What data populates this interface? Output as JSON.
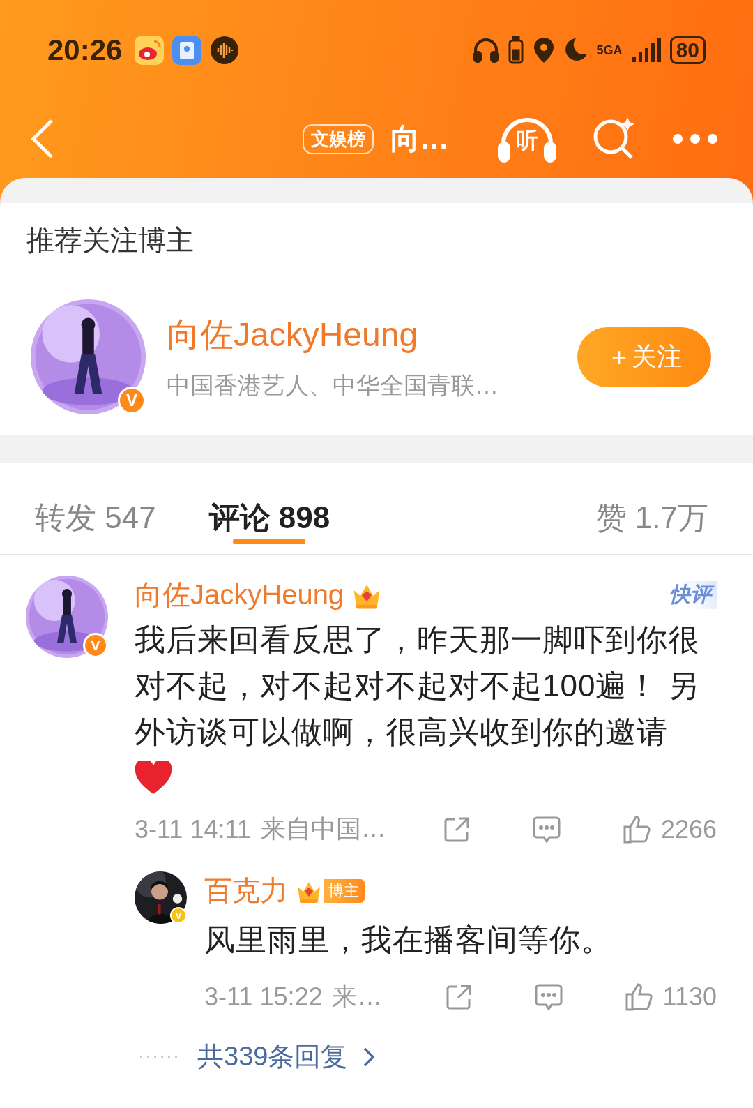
{
  "status_bar": {
    "time": "20:26",
    "network": "5GA",
    "battery": "80"
  },
  "nav": {
    "ranking_badge": "文娱榜",
    "title": "向…",
    "listen_label": "听"
  },
  "recommend": {
    "heading": "推荐关注博主",
    "user": {
      "name": "向佐JackyHeung",
      "verified_mark": "V",
      "bio": "中国香港艺人、中华全国青联…",
      "follow_button": "＋关注"
    }
  },
  "tabs": [
    {
      "label": "转发 547",
      "selected": false
    },
    {
      "label": "评论 898",
      "selected": true
    },
    {
      "label": "赞 1.7万",
      "selected": false
    }
  ],
  "comment": {
    "name": "向佐JackyHeung",
    "verified_mark": "V",
    "quick_badge": "快评",
    "text": "我后来回看反思了，昨天那一脚吓到你很对不起，对不起对不起对不起100遍！ 另外访谈可以做啊，很高兴收到你的邀请",
    "time": "3-11 14:11",
    "source": "来自中国…",
    "likes": "2266",
    "reply": {
      "name": "百克力",
      "verified_mark": "V",
      "role_badge": "博主",
      "text": "风里雨里，我在播客间等你。",
      "time": "3-11 15:22",
      "source": "来…",
      "likes": "1130"
    },
    "more_replies": "共339条回复"
  }
}
